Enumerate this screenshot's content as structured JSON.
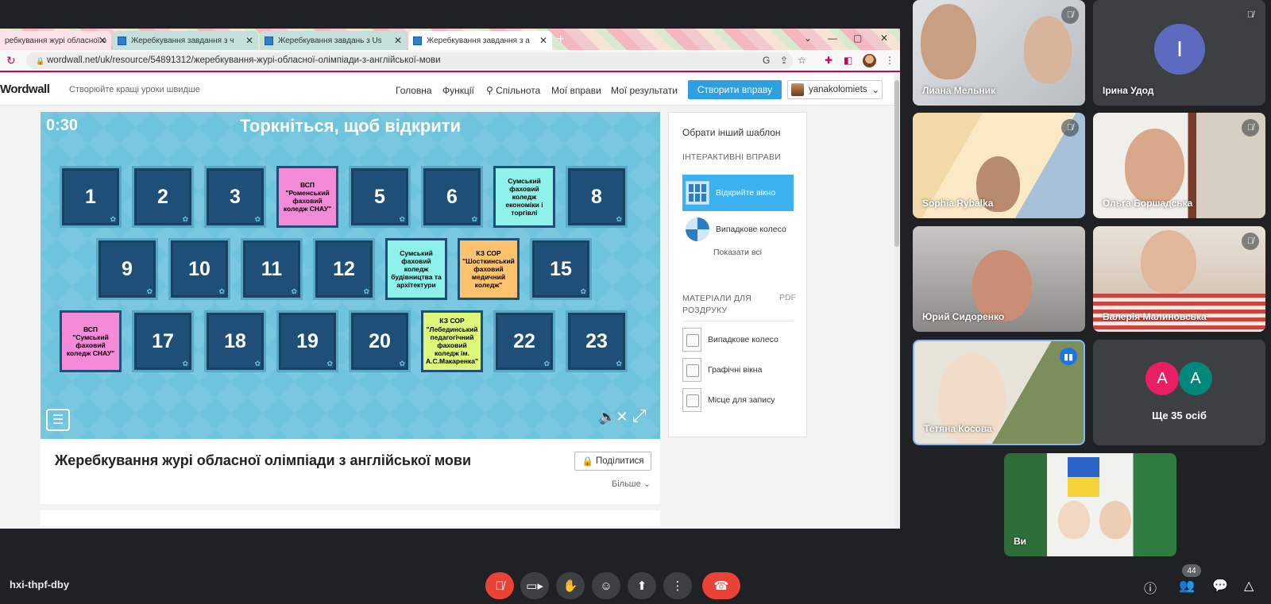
{
  "browser": {
    "tabs": [
      {
        "title": "ребкування журі обласної ол"
      },
      {
        "title": "Жеребкування завдання з чита"
      },
      {
        "title": "Жеребкування завдань з Use o"
      },
      {
        "title": "Жеребкування завдання з аудіо"
      }
    ],
    "url": "wordwall.net/uk/resource/54891312/жеребкування-журі-обласної-олімпіади-з-англійської-мови"
  },
  "wordwall_nav": {
    "logo": "Wordwall",
    "tagline": "Створюйте кращі уроки швидше",
    "links": [
      "Головна",
      "Функції",
      "Спільнота",
      "Мої вправи",
      "Мої результати"
    ],
    "create_button": "Створити вправу",
    "username": "yanakolomiets"
  },
  "game": {
    "timer": "0:30",
    "title": "Торкніться, щоб відкрити",
    "tiles": [
      {
        "label": "1"
      },
      {
        "label": "2"
      },
      {
        "label": "3"
      },
      {
        "label": "ВСП \"Роменський фаховий коледж СНАУ\""
      },
      {
        "label": "5"
      },
      {
        "label": "6"
      },
      {
        "label": "Сумський фаховий коледж економіки і торгівлі"
      },
      {
        "label": "8"
      },
      {
        "label": "9"
      },
      {
        "label": "10"
      },
      {
        "label": "11"
      },
      {
        "label": "12"
      },
      {
        "label": "Сумський фаховий коледж будівництва та архітектури"
      },
      {
        "label": "КЗ СОР \"Шосткинський фаховий медичний коледж\""
      },
      {
        "label": "15"
      },
      {
        "label": "ВСП \"Сумський фаховий коледж СНАУ\""
      },
      {
        "label": "17"
      },
      {
        "label": "18"
      },
      {
        "label": "19"
      },
      {
        "label": "20"
      },
      {
        "label": "КЗ СОР \"Лебединський педагогічний фаховий коледж ім. А.С.Макаренка\""
      },
      {
        "label": "22"
      },
      {
        "label": "23"
      }
    ],
    "colors": {
      "tile": "#1f4f77",
      "pink": "#f48bd8",
      "cyan": "#8ef2ea",
      "orange": "#ffc36e",
      "lime": "#dcf77a",
      "background": "#6ec3dd"
    }
  },
  "side_panel": {
    "title": "Обрати інший шаблон",
    "interactive_header": "ІНТЕРАКТИВНІ ВПРАВИ",
    "options": [
      "Відкрийте вікно",
      "Випадкове колесо"
    ],
    "show_all": "Показати всі",
    "print_header": "МАТЕРІАЛИ ДЛЯ РОЗДРУКУ",
    "pdf": "PDF",
    "print_items": [
      "Випадкове колесо",
      "Графічні вікна",
      "Місце для запису"
    ]
  },
  "activity": {
    "title": "Жеребкування журі обласної олімпіади з англійської мови",
    "share_button": "Поділитися",
    "more_link": "Більше"
  },
  "meet": {
    "participants": [
      {
        "name": "Лиана Мельник"
      },
      {
        "name": "Ірина Удод",
        "initial": "І"
      },
      {
        "name": "Sophia Rybalka"
      },
      {
        "name": "Ольга Боршадська"
      },
      {
        "name": "Юрий Сидоренко"
      },
      {
        "name": "Валерія Малиновська"
      },
      {
        "name": "Тетяна Косова"
      },
      {
        "name": "Ви"
      }
    ],
    "more_avatars": [
      "A",
      "A"
    ],
    "more_count": "Ще 35 осіб",
    "meeting_code": "hxi-thpf-dby",
    "people_count": "44"
  }
}
